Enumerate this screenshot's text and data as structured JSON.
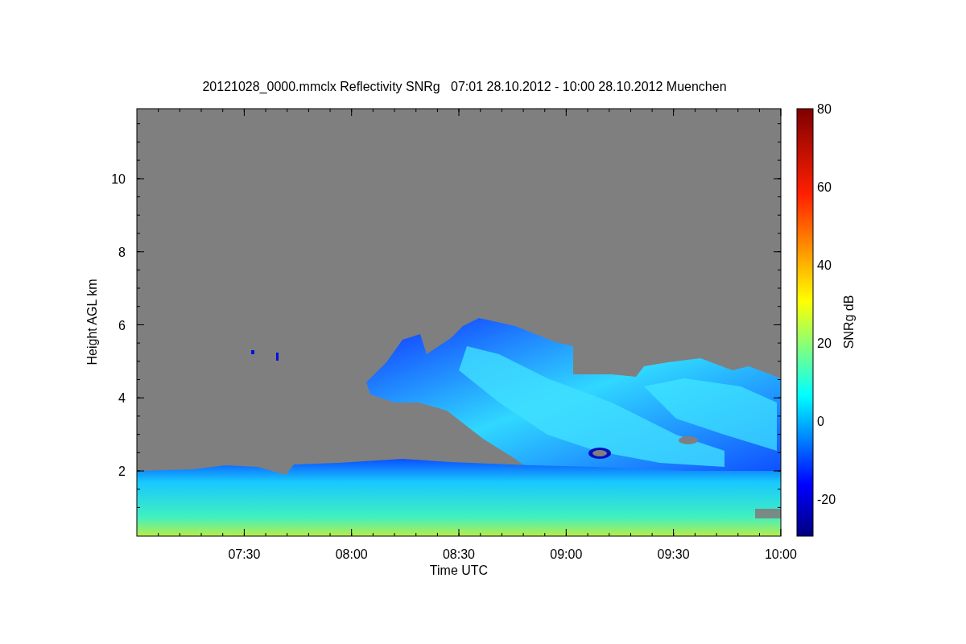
{
  "figure": {
    "title": "20121028_0000.mmclx Reflectivity SNRg   07:01 28.10.2012 - 10:00 28.10.2012 Muenchen",
    "xlabel": "Time UTC",
    "ylabel": "Height AGL km",
    "xticks": [
      "07:30",
      "08:00",
      "08:30",
      "09:00",
      "09:30",
      "10:00"
    ],
    "yticks": [
      "10",
      "8",
      "6",
      "4",
      "2"
    ],
    "colorbar": {
      "label": "SNRg dB",
      "ticks": [
        "80",
        "60",
        "40",
        "20",
        "0",
        "-20"
      ]
    }
  }
}
